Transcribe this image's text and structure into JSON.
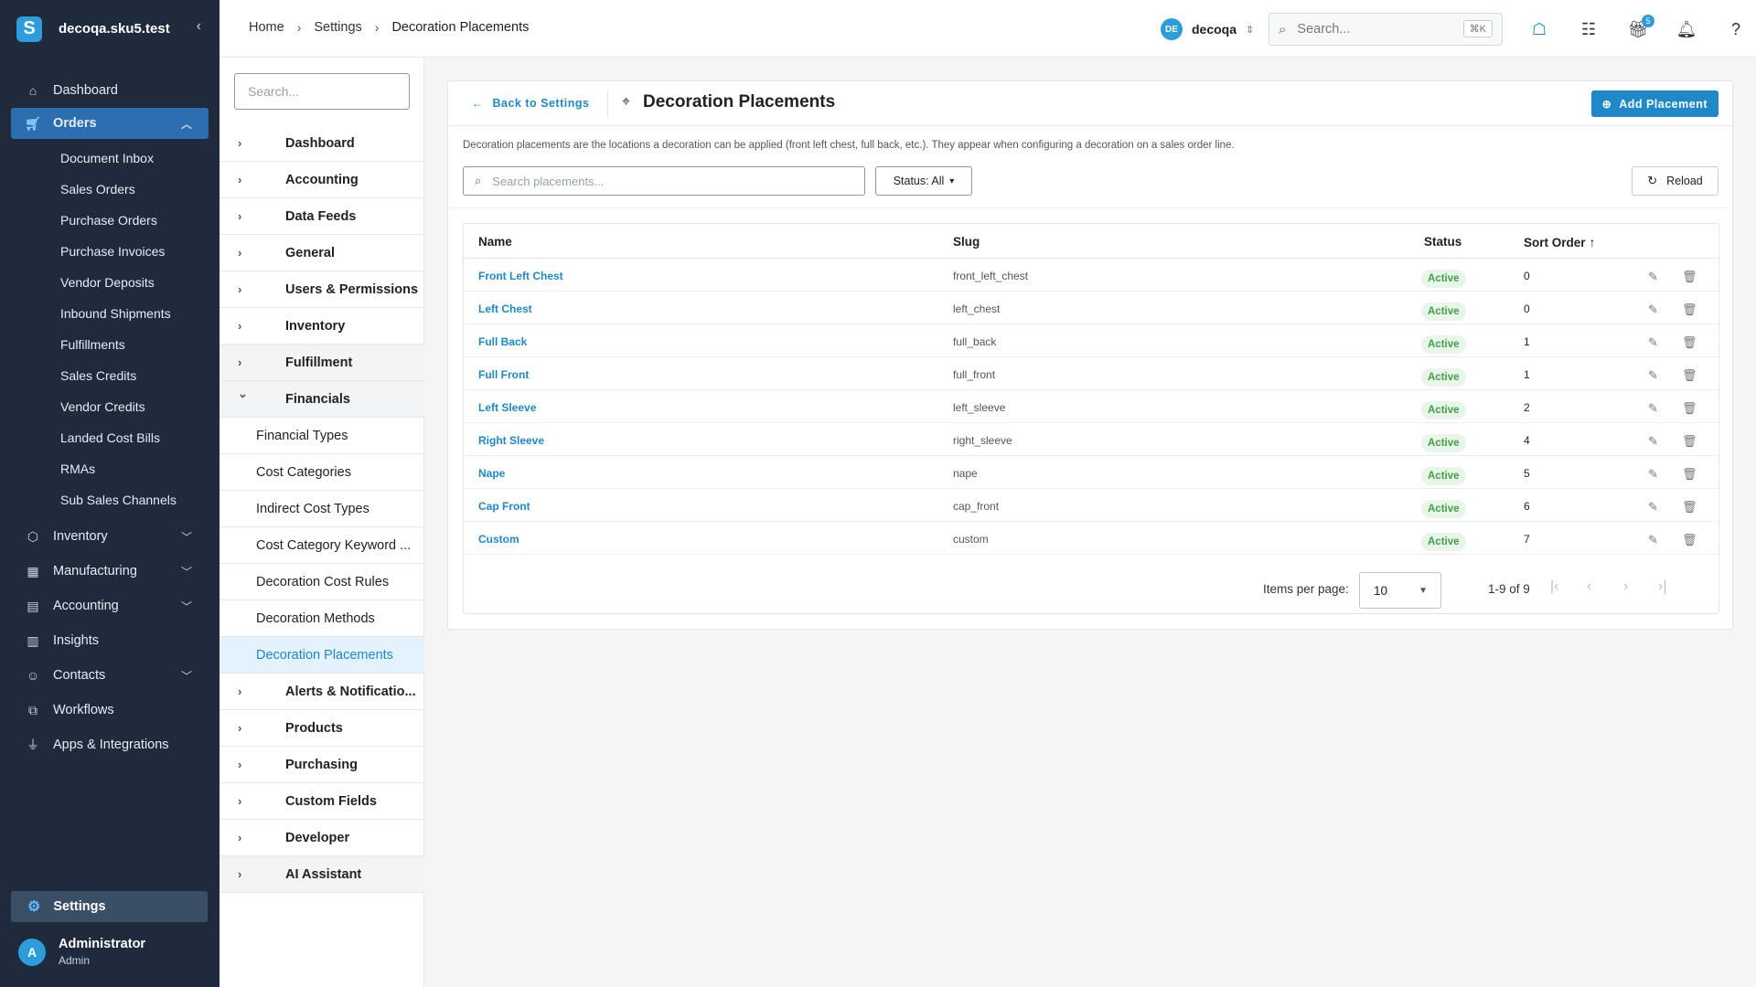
{
  "sidebar": {
    "workspace": "decoqa.sku5.test",
    "logo_letter": "S",
    "items": [
      {
        "label": "Dashboard",
        "icon": "home-icon"
      },
      {
        "label": "Orders",
        "icon": "cart-icon",
        "active": true
      },
      {
        "label": "Inventory",
        "icon": "box-icon"
      },
      {
        "label": "Manufacturing",
        "icon": "factory-icon"
      },
      {
        "label": "Accounting",
        "icon": "calculator-icon"
      },
      {
        "label": "Insights",
        "icon": "chart-icon"
      },
      {
        "label": "Contacts",
        "icon": "contacts-icon"
      },
      {
        "label": "Workflows",
        "icon": "workflow-icon"
      },
      {
        "label": "Apps & Integrations",
        "icon": "plug-icon"
      }
    ],
    "orders_sub": [
      "Document Inbox",
      "Sales Orders",
      "Purchase Orders",
      "Purchase Invoices",
      "Vendor Deposits",
      "Inbound Shipments",
      "Fulfillments",
      "Sales Credits",
      "Vendor Credits",
      "Landed Cost Bills",
      "RMAs",
      "Sub Sales Channels"
    ],
    "settings_label": "Settings",
    "user": {
      "initial": "A",
      "name": "Administrator",
      "role": "Admin"
    }
  },
  "topbar": {
    "breadcrumbs": [
      "Home",
      "Settings",
      "Decoration Placements"
    ],
    "tenant_badge": "DE",
    "tenant_name": "decoqa",
    "search_placeholder": "Search...",
    "search_shortcut": "⌘K",
    "gift_count": "5"
  },
  "settings_tree": {
    "search_placeholder": "Search...",
    "rows": [
      {
        "label": "Dashboard",
        "type": "parent"
      },
      {
        "label": "Accounting",
        "type": "parent"
      },
      {
        "label": "Data Feeds",
        "type": "parent"
      },
      {
        "label": "General",
        "type": "parent"
      },
      {
        "label": "Users & Permissions",
        "type": "parent"
      },
      {
        "label": "Inventory",
        "type": "parent"
      },
      {
        "label": "Fulfillment",
        "type": "parent",
        "shaded": true
      },
      {
        "label": "Financials",
        "type": "parent",
        "expanded": true,
        "shaded": true
      },
      {
        "label": "Financial Types",
        "type": "child"
      },
      {
        "label": "Cost Categories",
        "type": "child"
      },
      {
        "label": "Indirect Cost Types",
        "type": "child"
      },
      {
        "label": "Cost Category Keyword ...",
        "type": "child"
      },
      {
        "label": "Decoration Cost Rules",
        "type": "child"
      },
      {
        "label": "Decoration Methods",
        "type": "child"
      },
      {
        "label": "Decoration Placements",
        "type": "child",
        "selected": true
      },
      {
        "label": "Alerts & Notificatio...",
        "type": "parent"
      },
      {
        "label": "Products",
        "type": "parent"
      },
      {
        "label": "Purchasing",
        "type": "parent"
      },
      {
        "label": "Custom Fields",
        "type": "parent"
      },
      {
        "label": "Developer",
        "type": "parent"
      },
      {
        "label": "AI Assistant",
        "type": "parent",
        "shaded": true
      }
    ]
  },
  "page": {
    "back_label": "Back to Settings",
    "title": "Decoration Placements",
    "add_label": "Add Placement",
    "description": "Decoration placements are the locations a decoration can be applied (front left chest, full back, etc.). They appear when configuring a decoration on a sales order line.",
    "search_placeholder": "Search placements...",
    "status_filter": "Status: All",
    "reload_label": "Reload",
    "columns": {
      "name": "Name",
      "slug": "Slug",
      "status": "Status",
      "sort_order": "Sort Order"
    },
    "rows": [
      {
        "name": "Front Left Chest",
        "slug": "front_left_chest",
        "status": "Active",
        "sort": "0"
      },
      {
        "name": "Left Chest",
        "slug": "left_chest",
        "status": "Active",
        "sort": "0"
      },
      {
        "name": "Full Back",
        "slug": "full_back",
        "status": "Active",
        "sort": "1"
      },
      {
        "name": "Full Front",
        "slug": "full_front",
        "status": "Active",
        "sort": "1"
      },
      {
        "name": "Left Sleeve",
        "slug": "left_sleeve",
        "status": "Active",
        "sort": "2"
      },
      {
        "name": "Right Sleeve",
        "slug": "right_sleeve",
        "status": "Active",
        "sort": "4"
      },
      {
        "name": "Nape",
        "slug": "nape",
        "status": "Active",
        "sort": "5"
      },
      {
        "name": "Cap Front",
        "slug": "cap_front",
        "status": "Active",
        "sort": "6"
      },
      {
        "name": "Custom",
        "slug": "custom",
        "status": "Active",
        "sort": "7"
      }
    ],
    "pager": {
      "items_per_page_label": "Items per page:",
      "items_per_page": "10",
      "range": "1-9 of 9"
    }
  },
  "colors": {
    "accent": "#1e88c9",
    "sidebar_bg": "#1f2b3d",
    "active_badge_bg": "#e8f5e9",
    "active_badge_text": "#43a047"
  }
}
